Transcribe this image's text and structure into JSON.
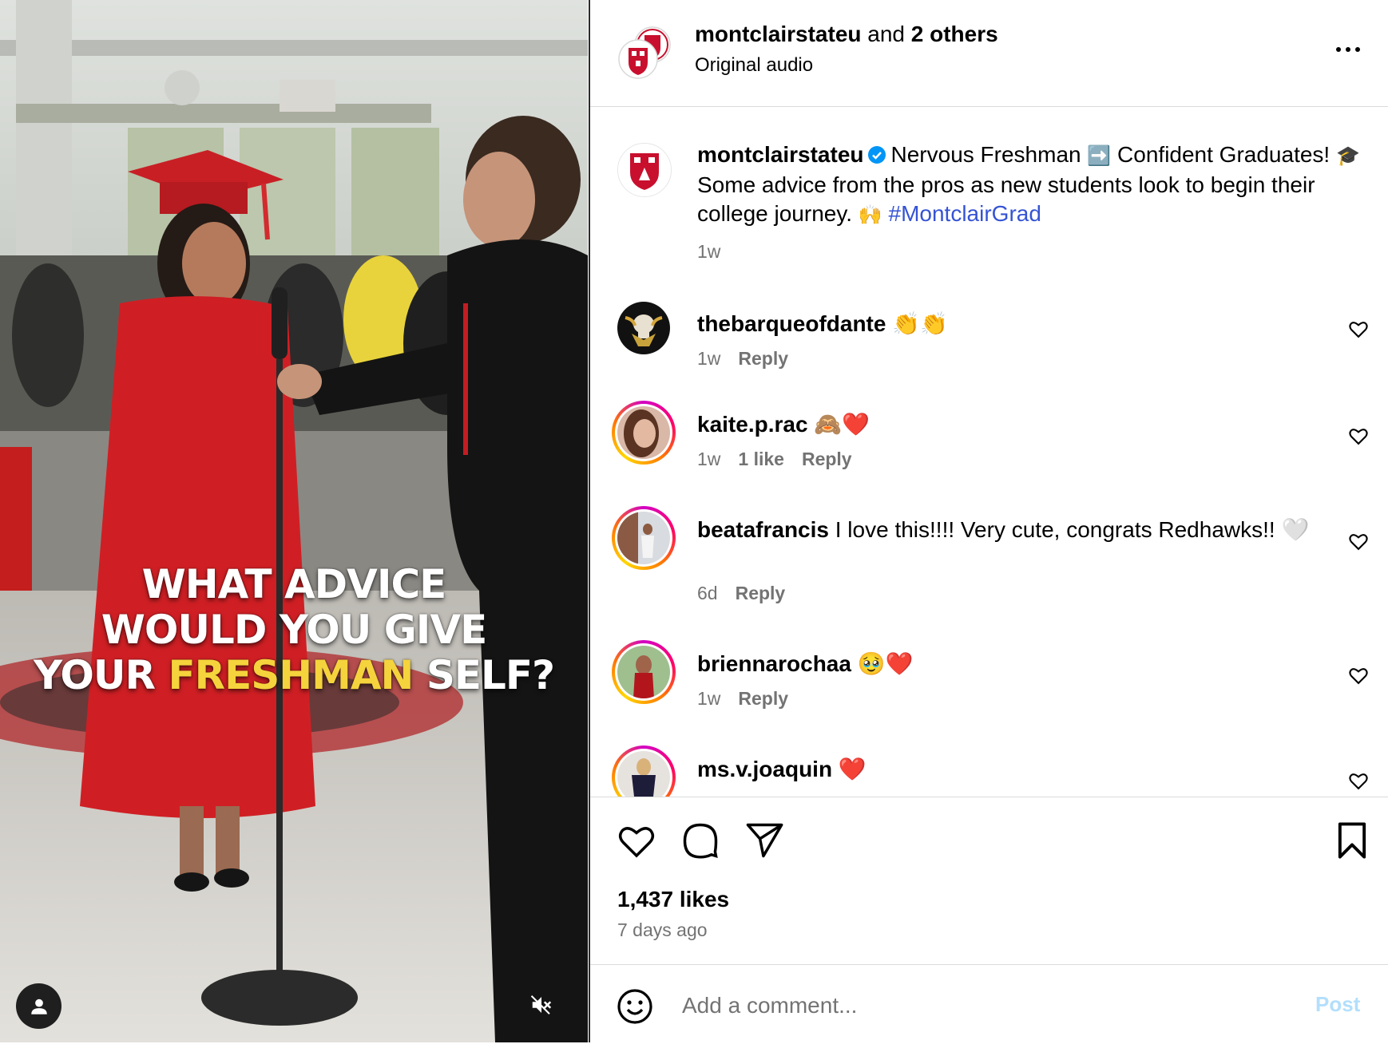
{
  "video": {
    "caption_line1": "WHAT ADVICE",
    "caption_line2": "WOULD YOU GIVE",
    "caption_line3_a": "YOUR ",
    "caption_line3_highlight": "FRESHMAN",
    "caption_line3_b": " SELF?",
    "user_icon": "user-icon",
    "mute_icon": "speaker-muted-icon"
  },
  "header": {
    "account": "montclairstateu",
    "and_text": " and ",
    "others": "2 others",
    "subtitle": "Original audio",
    "more_icon": "more-dots-icon"
  },
  "caption": {
    "username": "montclairstateu",
    "text_1": "Nervous Freshman ",
    "arrow_emoji": "➡️",
    "text_2": " Confident Graduates! ",
    "cap_emoji": "🎓",
    "text_3": " Some advice from the pros as new students look to begin their college journey. ",
    "hands_emoji": "🙌",
    "hashtag": "#MontclairGrad",
    "time": "1w"
  },
  "comments": [
    {
      "username": "thebarqueofdante",
      "text": "👏👏",
      "time": "1w",
      "likes": "",
      "reply": "Reply"
    },
    {
      "username": "kaite.p.rac",
      "text": "🙈❤️",
      "time": "1w",
      "likes": "1 like",
      "reply": "Reply"
    },
    {
      "username": "beatafrancis",
      "text": "I love this!!!! Very cute, congrats Redhawks!! 🤍",
      "time": "6d",
      "likes": "",
      "reply": "Reply"
    },
    {
      "username": "briennarochaa",
      "text": "🥹❤️",
      "time": "1w",
      "likes": "",
      "reply": "Reply"
    },
    {
      "username": "ms.v.joaquin",
      "text": "❤️",
      "time": "",
      "likes": "",
      "reply": ""
    }
  ],
  "stats": {
    "likes": "1,437 likes",
    "posted": "7 days ago"
  },
  "comment_box": {
    "placeholder": "Add a comment...",
    "post_label": "Post"
  },
  "colors": {
    "hashtag": "#3553d4",
    "post_disabled": "#b2dffc",
    "muted_text": "#737373",
    "caption_highlight": "#f5d33c",
    "gown_red": "#cf1f24"
  }
}
